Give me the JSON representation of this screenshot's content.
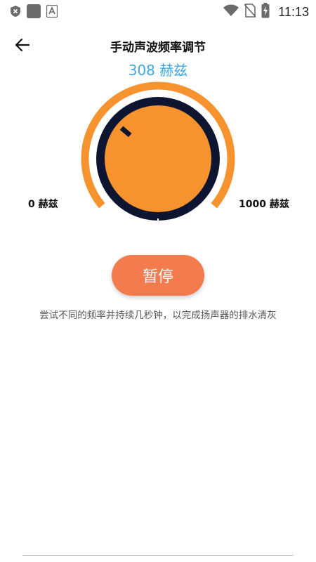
{
  "status_bar": {
    "time": "11:13",
    "icons_left": [
      "shield-x-icon",
      "app-square-icon",
      "translate-a-icon"
    ],
    "icons_right": [
      "wifi-icon",
      "no-sim-icon",
      "battery-charging-icon"
    ]
  },
  "header": {
    "back_icon": "arrow-left-icon",
    "title": "手动声波频率调节"
  },
  "frequency": {
    "current": "308 赫兹",
    "value": 308,
    "min_label": "0 赫兹",
    "max_label": "1000 赫兹",
    "min": 0,
    "max": 1000
  },
  "controls": {
    "pause_label": "暂停"
  },
  "hint": "尝试不同的频率并持续几秒钟，以完成扬声器的排水清灰",
  "colors": {
    "accent_orange": "#f7932f",
    "knob_ring": "#0d1530",
    "button": "#f37b4e",
    "readout_blue": "#3fa9e6"
  }
}
